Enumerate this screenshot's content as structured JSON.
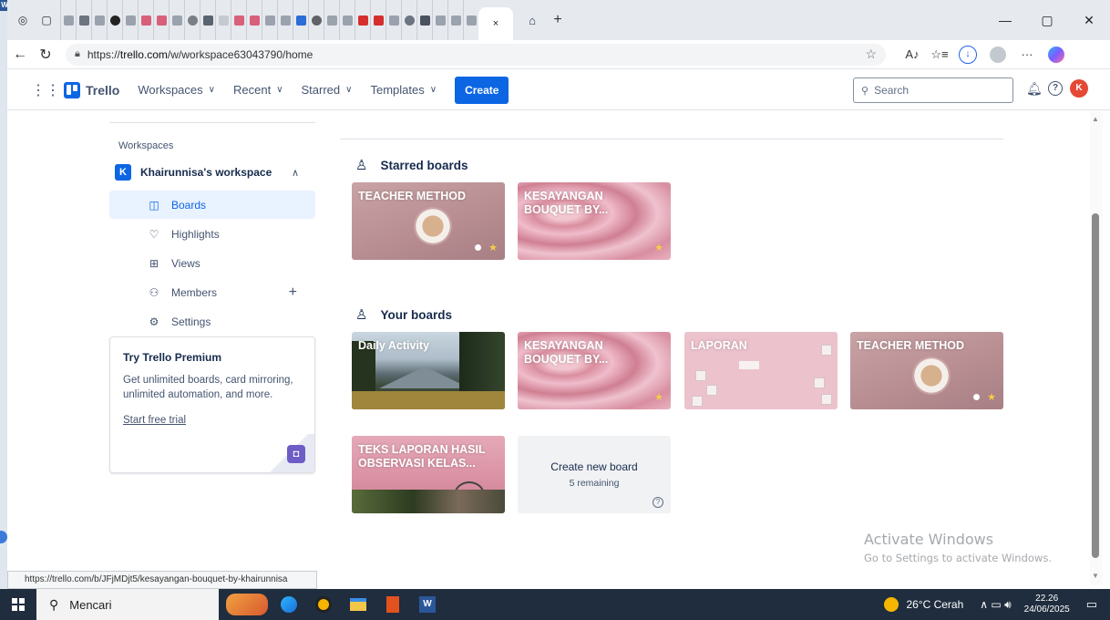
{
  "browser": {
    "url_prefix": "https://",
    "url_host": "trello.com",
    "url_path": "/w/workspace63043790/home",
    "active_tab_close": "×",
    "new_tab": "+",
    "status_url": "https://trello.com/b/JFjMDjt5/kesayangan-bouquet-by-khairunnisa"
  },
  "header": {
    "brand": "Trello",
    "nav": [
      "Workspaces",
      "Recent",
      "Starred",
      "Templates"
    ],
    "create_label": "Create",
    "search_placeholder": "Search",
    "avatar_initial": "K"
  },
  "sidebar": {
    "heading": "Workspaces",
    "workspace_initial": "K",
    "workspace_name": "Khairunnisa's workspace",
    "items": [
      {
        "label": "Boards",
        "icon": "board-icon"
      },
      {
        "label": "Highlights",
        "icon": "heart-icon"
      },
      {
        "label": "Views",
        "icon": "views-grid-icon"
      },
      {
        "label": "Members",
        "icon": "members-icon"
      },
      {
        "label": "Settings",
        "icon": "gear-icon"
      }
    ],
    "premium": {
      "title": "Try Trello Premium",
      "description": "Get unlimited boards, card mirroring, unlimited automation, and more.",
      "link": "Start free trial"
    }
  },
  "main": {
    "starred_title": "Starred boards",
    "your_title": "Your boards",
    "starred_boards": [
      {
        "title": "TEACHER METHOD"
      },
      {
        "title": "KESAYANGAN BOUQUET BY..."
      }
    ],
    "your_boards": [
      {
        "title": "Daily Activity"
      },
      {
        "title": "KESAYANGAN BOUQUET BY..."
      },
      {
        "title": "LAPORAN"
      },
      {
        "title": "TEACHER METHOD"
      },
      {
        "title": "TEKS LAPORAN HASIL OBSERVASI KELAS..."
      }
    ],
    "create_board": {
      "label": "Create new board",
      "remaining": "5 remaining"
    }
  },
  "watermark": {
    "line1": "Activate Windows",
    "line2": "Go to Settings to activate Windows."
  },
  "taskbar": {
    "search_label": "Mencari",
    "weather": "26°C Cerah",
    "time": "22.26",
    "date": "24/06/2025"
  },
  "colors": {
    "trello_blue": "#0c66e4",
    "selected_bg": "#e9f2ff",
    "star": "#f5cd47",
    "taskbar": "#1f2d3e"
  }
}
